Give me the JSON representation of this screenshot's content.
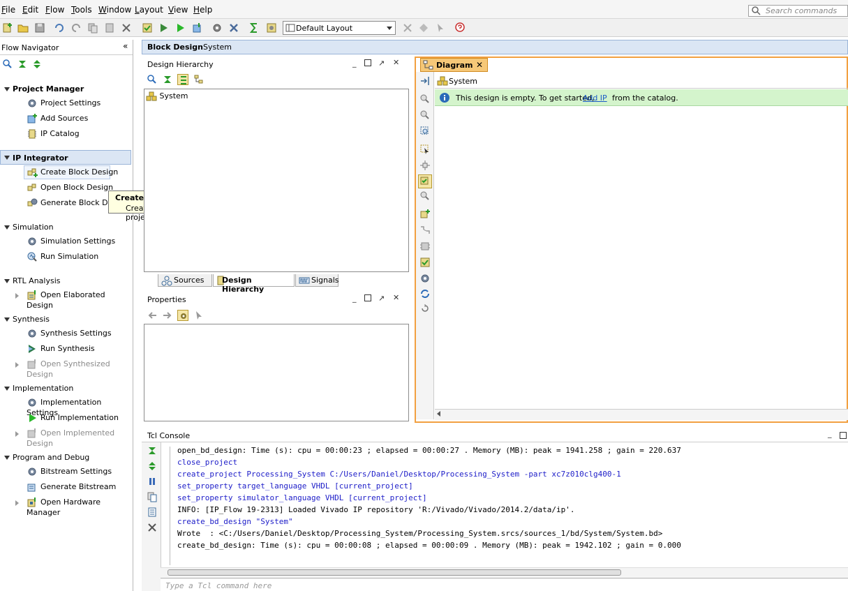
{
  "menu": [
    "File",
    "Edit",
    "Flow",
    "Tools",
    "Window",
    "Layout",
    "View",
    "Help"
  ],
  "search": {
    "placeholder": "Search commands"
  },
  "toolbar": {
    "layout_value": "Default Layout"
  },
  "flow_navigator": {
    "title": "Flow Navigator",
    "sections": [
      {
        "label": "Project Manager",
        "items": [
          "Project Settings",
          "Add Sources",
          "IP Catalog"
        ]
      },
      {
        "label": "IP Integrator",
        "items": [
          "Create Block Design",
          "Open Block Design",
          "Generate Block Desi"
        ]
      },
      {
        "label": "Simulation",
        "items": [
          "Simulation Settings",
          "Run Simulation"
        ]
      },
      {
        "label": "RTL Analysis",
        "items": [
          "Open Elaborated Design"
        ]
      },
      {
        "label": "Synthesis",
        "items": [
          "Synthesis Settings",
          "Run Synthesis",
          "Open Synthesized Design"
        ]
      },
      {
        "label": "Implementation",
        "items": [
          "Implementation Settings",
          "Run Implementation",
          "Open Implemented Design"
        ]
      },
      {
        "label": "Program and Debug",
        "items": [
          "Bitstream Settings",
          "Generate Bitstream",
          "Open Hardware Manager"
        ]
      }
    ]
  },
  "tooltip": {
    "title": "Create Block Design",
    "text": "Create and add an IP subsystem to the project."
  },
  "block_design": {
    "title": "Block Design",
    "subtitle": "System"
  },
  "design_hierarchy": {
    "title": "Design Hierarchy",
    "tree_root": "System",
    "tabs": [
      "Sources",
      "Design Hierarchy",
      "Signals"
    ]
  },
  "properties": {
    "title": "Properties"
  },
  "diagram": {
    "tab_label": "Diagram",
    "breadcrumb": "System",
    "info_prefix": "This design is empty. To get started,",
    "info_link": "Add IP",
    "info_suffix": "from the catalog."
  },
  "tcl_console": {
    "title": "Tcl Console",
    "lines": [
      {
        "text": "open_bd_design: Time (s): cpu = 00:00:23 ; elapsed = 00:00:27 . Memory (MB): peak = 1941.258 ; gain = 220.637",
        "cmd": false
      },
      {
        "text": "close_project",
        "cmd": true
      },
      {
        "text": "create_project Processing_System C:/Users/Daniel/Desktop/Processing_System -part xc7z010clg400-1",
        "cmd": true
      },
      {
        "text": "set_property target_language VHDL [current_project]",
        "cmd": true
      },
      {
        "text": "set_property simulator_language VHDL [current_project]",
        "cmd": true
      },
      {
        "text": "INFO: [IP_Flow 19-2313] Loaded Vivado IP repository 'R:/Vivado/Vivado/2014.2/data/ip'.",
        "cmd": false
      },
      {
        "text": "create_bd_design \"System\"",
        "cmd": true
      },
      {
        "text": "Wrote  : <C:/Users/Daniel/Desktop/Processing_System/Processing_System.srcs/sources_1/bd/System/System.bd>",
        "cmd": false
      },
      {
        "text": "create_bd_design: Time (s): cpu = 00:00:08 ; elapsed = 00:00:09 . Memory (MB): peak = 1942.102 ; gain = 0.000",
        "cmd": false
      }
    ],
    "input_placeholder": "Type a Tcl command here"
  }
}
